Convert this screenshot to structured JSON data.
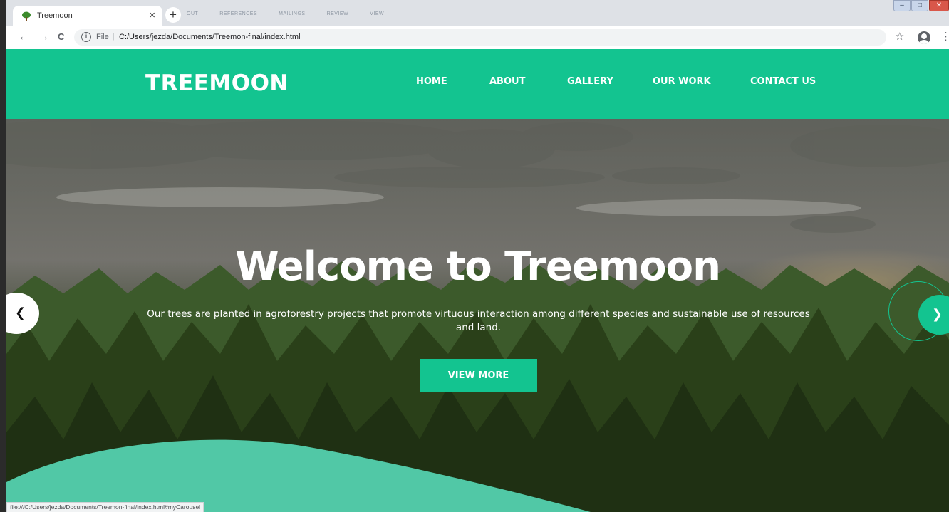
{
  "browser": {
    "tab_title": "Treemoon",
    "tab_close": "×",
    "new_tab": "+",
    "ghost_tabs": [
      "OUT",
      "REFERENCES",
      "MAILINGS",
      "REVIEW",
      "VIEW"
    ],
    "window_controls": [
      "–",
      "□",
      "✕"
    ],
    "back": "←",
    "forward": "→",
    "reload": "C",
    "url_scheme": "File",
    "url_separator": "|",
    "url": "C:/Users/jezda/Documents/Treemon-final/index.html",
    "bookmark_star": "☆",
    "menu": "⋮",
    "status_url": "file:///C:/Users/jezda/Documents/Treemon-final/index.html#myCarousel"
  },
  "site": {
    "brand": "TREEMOON",
    "nav": [
      {
        "label": "HOME"
      },
      {
        "label": "ABOUT"
      },
      {
        "label": "GALLERY"
      },
      {
        "label": "OUR WORK"
      },
      {
        "label": "CONTACT US"
      }
    ],
    "hero": {
      "title": "Welcome to Treemoon",
      "text": "Our trees are planted in agroforestry projects that promote virtuous interaction among different species and sustainable use of resources and land.",
      "button": "VIEW MORE",
      "prev": "‹",
      "next": "›"
    }
  },
  "colors": {
    "brand_green": "#13c490",
    "wave_green": "#51c8a6",
    "tabstrip": "#dee1e6"
  },
  "icons": {
    "favicon": "tree-icon",
    "info": "info-icon",
    "profile": "account-circle-icon"
  }
}
